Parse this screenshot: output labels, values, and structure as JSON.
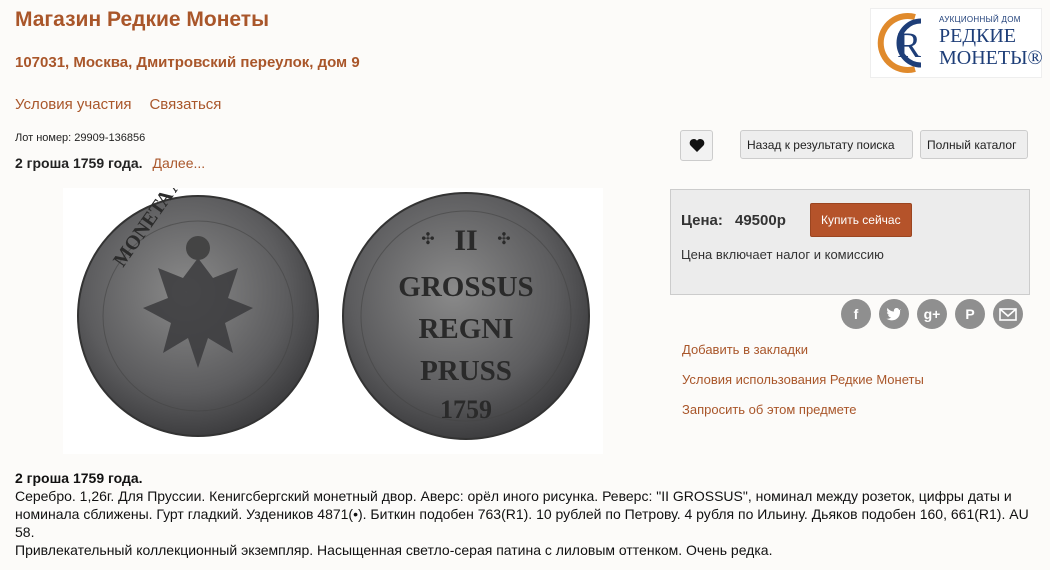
{
  "header": {
    "shop_title": "Магазин Редкие Монеты",
    "address": "107031, Москва, Дмитровский переулок, дом 9",
    "logo": {
      "letter": "R",
      "small_text": "АУКЦИОННЫЙ ДОМ",
      "line1": "РЕДКИЕ",
      "line2": "МОНЕТЫ®"
    }
  },
  "nav": {
    "terms": "Условия участия",
    "contact": "Связаться"
  },
  "lot": {
    "number_text": "Лот номер: 29909-136856",
    "title": "2 гроша 1759 года.",
    "more_link": "Далее...",
    "coin_image_icon": "coin-photo-obverse-reverse"
  },
  "toolbar": {
    "favorite_icon": "heart-icon",
    "back_button": "Назад к результату поиска",
    "catalog_button": "Полный каталог"
  },
  "price": {
    "label": "Цена:",
    "value": "49500р",
    "buy_button": "Купить сейчас",
    "note": "Цена включает налог и комиссию"
  },
  "social": [
    "facebook-icon",
    "twitter-icon",
    "google-plus-icon",
    "pinterest-icon",
    "email-icon"
  ],
  "side_links": {
    "bookmark": "Добавить в закладки",
    "terms_of_use": "Условия использования Редкие Монеты",
    "inquire": "Запросить об этом предмете"
  },
  "description": {
    "title": "2 гроша 1759 года.",
    "body": "Серебро. 1,26г. Для Пруссии. Кенигсбергский монетный двор. Аверс: орёл иного рисунка. Реверс: \"II GROSSUS\", номинал между розеток, цифры даты и номинала сближены. Гурт гладкий. Уздеников 4871(•). Биткин подобен 763(R1). 10 рублей по Петрову. 4 рубля по Ильину. Дьяков подобен 160, 661(R1). AU 58.",
    "note": "Привлекательный коллекционный экземпляр. Насыщенная светло-серая патина с лиловым оттенком. Очень редка."
  },
  "coin_text": {
    "reverse_line1": "II",
    "reverse_line2": "GROSSUS",
    "reverse_line3": "REGNI",
    "reverse_line4": "PRUSS",
    "reverse_year": "1759",
    "obverse_legend": "MONETA ARGENTEA"
  },
  "colors": {
    "accent": "#a9562a",
    "buy_button": "#b5532a",
    "logo_blue": "#1e3e78",
    "social_gray": "#8f8f8f"
  }
}
